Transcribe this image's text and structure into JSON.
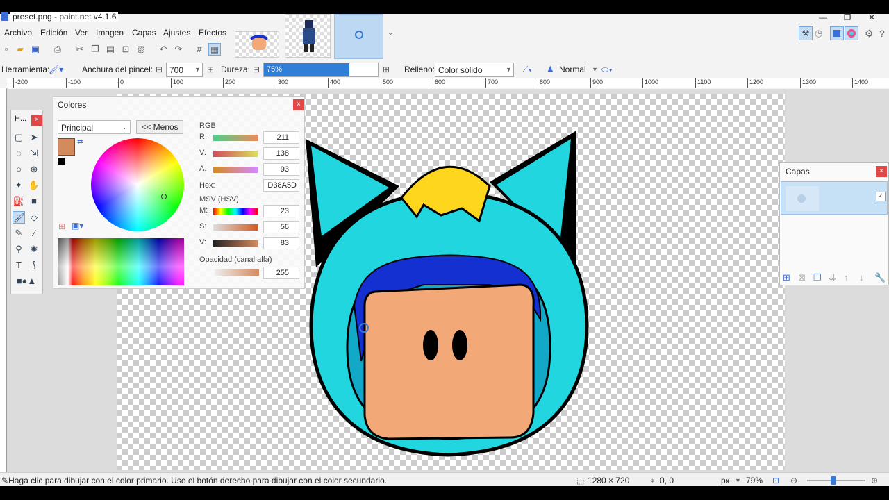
{
  "window": {
    "title": "preset.png - paint.net v4.1.6"
  },
  "menu": [
    "Archivo",
    "Edición",
    "Ver",
    "Imagen",
    "Capas",
    "Ajustes",
    "Efectos"
  ],
  "toolbar2": {
    "tool_label": "Herramienta:",
    "brush_width_label": "Anchura del pincel:",
    "brush_width_value": "700",
    "hardness_label": "Dureza:",
    "hardness_value": "75%",
    "hardness_fraction": 0.75,
    "fill_label": "Relleno:",
    "fill_value": "Color sólido",
    "blend_mode": "Normal"
  },
  "ruler_ticks": [
    "-200",
    "-100",
    "0",
    "100",
    "200",
    "300",
    "400",
    "500",
    "600",
    "700",
    "800",
    "900",
    "1000",
    "1100",
    "1200",
    "1300",
    "1400"
  ],
  "tools_panel": {
    "title": "H..."
  },
  "colors_panel": {
    "title": "Colores",
    "palette_select": "Principal",
    "less_button": "<< Menos",
    "primary_color": "#D38A5D",
    "secondary_color": "#FFFFFF",
    "rgb_label": "RGB",
    "r_label": "R:",
    "r_value": "211",
    "g_label": "V:",
    "g_value": "138",
    "b_label": "A:",
    "b_value": "93",
    "hex_label": "Hex:",
    "hex_value": "D38A5D",
    "hsv_label": "MSV (HSV)",
    "h_label": "M:",
    "h_value": "23",
    "s_label": "S:",
    "s_value": "56",
    "v_label": "V:",
    "v_value": "83",
    "alpha_label": "Opacidad (canal alfa)",
    "alpha_value": "255"
  },
  "layers_panel": {
    "title": "Capas"
  },
  "status": {
    "hint": "Haga clic para dibujar con el color primario. Use el botón derecho para dibujar con el color secundario.",
    "size": "1280 × 720",
    "position": "0, 0",
    "unit": "px",
    "zoom": "79%"
  },
  "icons": {
    "close": "close-icon",
    "settings": "gear-icon",
    "help": "help-icon"
  },
  "colors": {
    "accent": "#3a7bd5",
    "hood": "#22d6e0",
    "face": "#f3a877",
    "hair": "#1530d0",
    "ears": "#ffd61e"
  }
}
